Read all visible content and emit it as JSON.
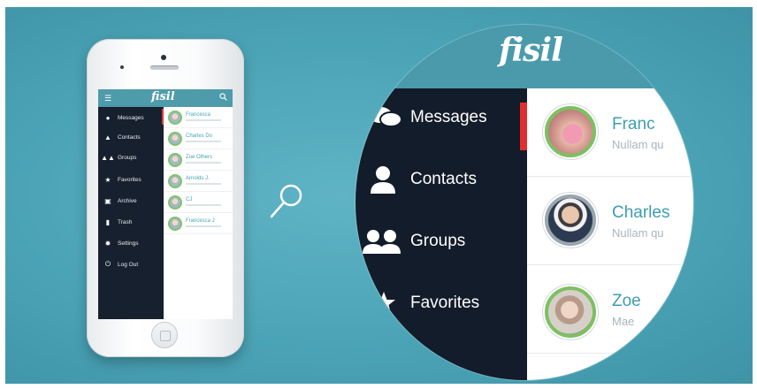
{
  "app": {
    "logo": "fisil"
  },
  "menu": [
    {
      "label": "Messages",
      "icon": "chat-bubbles-icon"
    },
    {
      "label": "Contacts",
      "icon": "person-icon"
    },
    {
      "label": "Groups",
      "icon": "people-icon"
    },
    {
      "label": "Favorites",
      "icon": "star-icon"
    },
    {
      "label": "Archive",
      "icon": "archive-box-icon"
    },
    {
      "label": "Trash",
      "icon": "trash-icon"
    },
    {
      "label": "Settings",
      "icon": "gear-icon"
    },
    {
      "label": "Log Out",
      "icon": "power-icon"
    }
  ],
  "phone_contacts": [
    {
      "name": "Francesca"
    },
    {
      "name": "Charles Do"
    },
    {
      "name": "Zoe Others"
    },
    {
      "name": "Arnolds J."
    },
    {
      "name": "CJ"
    },
    {
      "name": "Francesca J"
    }
  ],
  "zoom_contacts": [
    {
      "name": "Franc",
      "snippet": "Nullam qu"
    },
    {
      "name": "Charles",
      "snippet": "Nullam qu"
    },
    {
      "name": "Zoe",
      "snippet": "Mae"
    }
  ],
  "colors": {
    "background": "#4ba4b6",
    "header": "#4a9aab",
    "sidebar": "#131c2a",
    "accent": "#e02f2f",
    "name_text": "#3d9db3",
    "avatar_ring": "#7dc062"
  }
}
